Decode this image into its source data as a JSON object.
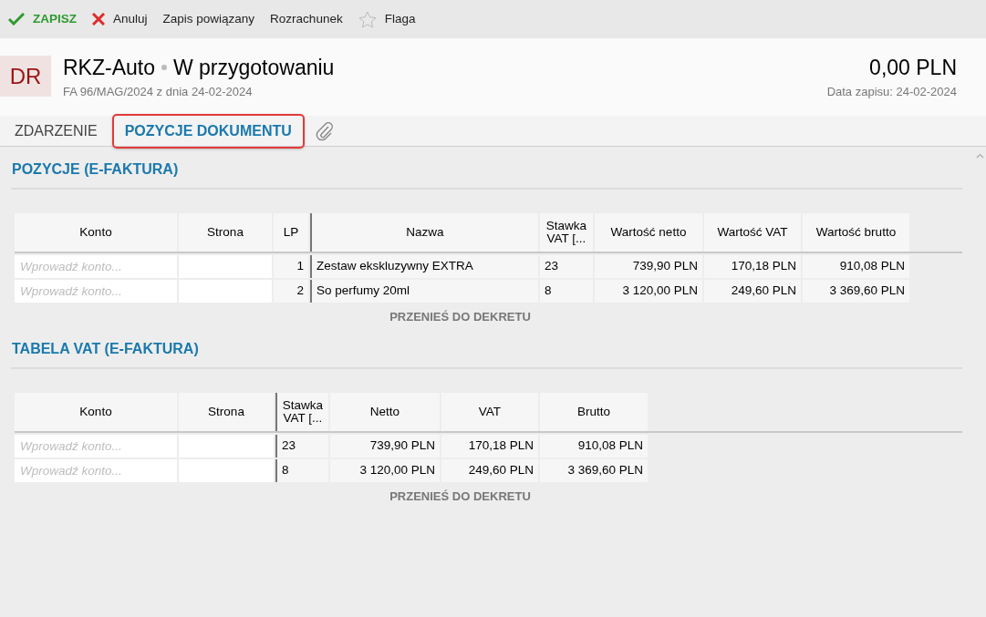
{
  "toolbar": [
    {
      "kind": "save",
      "label": "ZAPISZ"
    },
    {
      "kind": "cancel",
      "label": "Anuluj"
    },
    {
      "kind": "plain",
      "label": "Zapis powiązany"
    },
    {
      "kind": "plain",
      "label": "Rozrachunek"
    },
    {
      "kind": "flag",
      "label": "Flaga"
    }
  ],
  "header": {
    "badge": "DR",
    "title": "RKZ-Auto",
    "status": "W przygotowaniu",
    "subtitle": "FA 96/MAG/2024 z dnia 24-02-2024",
    "amount": "0,00 PLN",
    "date": "Data zapisu: 24-02-2024"
  },
  "tabs": [
    {
      "kind": "text",
      "label": "ZDARZENIE",
      "selected": false
    },
    {
      "kind": "text",
      "label": "POZYCJE DOKUMENTU",
      "selected": true
    },
    {
      "kind": "attachment",
      "selected": false
    }
  ],
  "sections": [
    {
      "title": "POZYCJE (E-FAKTURA)",
      "columns": [
        {
          "kind": "account",
          "label": "Konto"
        },
        {
          "kind": "side",
          "label": "Strona"
        },
        {
          "kind": "lp",
          "label": "LP"
        },
        {
          "kind": "text",
          "label": "Nazwa"
        },
        {
          "kind": "rate",
          "label": "Stawka VAT [..."
        },
        {
          "kind": "money",
          "label": "Wartość netto"
        },
        {
          "kind": "money",
          "label": "Wartość VAT"
        },
        {
          "kind": "money",
          "label": "Wartość brutto"
        }
      ],
      "rows": [
        {
          "account_placeholder": "Wprowadź konto...",
          "values": [
            "1",
            "Zestaw ekskluzywny EXTRA",
            "23",
            "739,90 PLN",
            "170,18 PLN",
            "910,08 PLN"
          ]
        },
        {
          "account_placeholder": "Wprowadź konto...",
          "values": [
            "2",
            "So perfumy 20ml",
            "8",
            "3 120,00 PLN",
            "249,60 PLN",
            "3 369,60 PLN"
          ]
        }
      ],
      "action": "PRZENIEŚ DO DEKRETU"
    },
    {
      "title": "TABELA VAT (E-FAKTURA)",
      "columns": [
        {
          "kind": "account",
          "label": "Konto"
        },
        {
          "kind": "side",
          "label": "Strona"
        },
        {
          "kind": "rate",
          "label": "Stawka VAT [..."
        },
        {
          "kind": "money",
          "label": "Netto"
        },
        {
          "kind": "money",
          "label": "VAT"
        },
        {
          "kind": "money",
          "label": "Brutto"
        }
      ],
      "rows": [
        {
          "account_placeholder": "Wprowadź konto...",
          "values": [
            "23",
            "739,90 PLN",
            "170,18 PLN",
            "910,08 PLN"
          ]
        },
        {
          "account_placeholder": "Wprowadź konto...",
          "values": [
            "8",
            "3 120,00 PLN",
            "249,60 PLN",
            "3 369,60 PLN"
          ]
        }
      ],
      "action": "PRZENIEŚ DO DEKRETU"
    }
  ]
}
